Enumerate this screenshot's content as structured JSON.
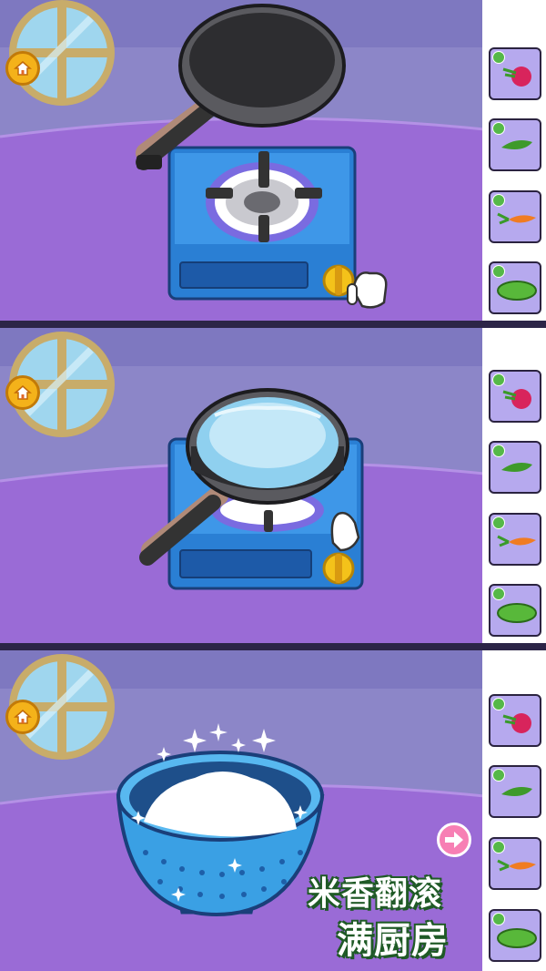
{
  "panels": [
    {
      "step": "stove",
      "home_icon": "home-icon",
      "hand_icon": "pointing-hand-icon",
      "pan": "frying-pan",
      "appliance": "gas-stove"
    },
    {
      "step": "boil",
      "home_icon": "home-icon",
      "hand_icon": "pointing-hand-icon",
      "pan": "pot-with-rice-water",
      "appliance": "gas-stove"
    },
    {
      "step": "drain",
      "home_icon": "home-icon",
      "item": "colander-with-rice"
    }
  ],
  "sidebar": {
    "items": [
      {
        "name": "radish",
        "checked": true,
        "color": "#d8245c"
      },
      {
        "name": "green-pepper",
        "checked": true,
        "color": "#3e9a2a"
      },
      {
        "name": "carrot",
        "checked": true,
        "color": "#f07c22"
      },
      {
        "name": "cucumber",
        "checked": true,
        "color": "#58b83a"
      }
    ]
  },
  "slogan": {
    "line1": "米香翻滚",
    "line2": "满厨房"
  },
  "colors": {
    "wall": "#8c86c8",
    "floor": "#9a6bd6",
    "stove": "#2a7fd4",
    "accent": "#f4b21a",
    "next_button": "#f77fb4"
  }
}
